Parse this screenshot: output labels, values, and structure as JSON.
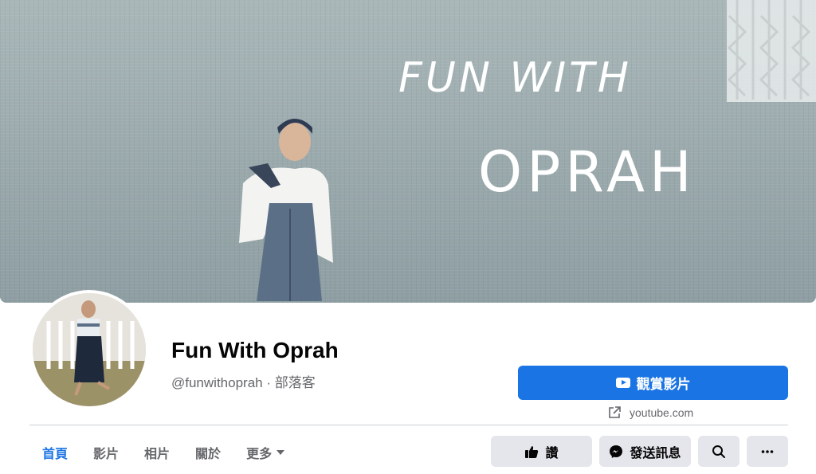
{
  "cover": {
    "text_line1": "FUN WITH",
    "text_line2": "OPRAH"
  },
  "page": {
    "name": "Fun With Oprah",
    "handle_category": "@funwithoprah · 部落客"
  },
  "actions": {
    "watch_label": "觀賞影片",
    "website": "youtube.com",
    "like_label": "讚",
    "message_label": "發送訊息"
  },
  "tabs": [
    {
      "label": "首頁",
      "active": true
    },
    {
      "label": "影片"
    },
    {
      "label": "相片"
    },
    {
      "label": "關於"
    },
    {
      "label": "更多"
    }
  ],
  "icons": {
    "watch": "play-icon",
    "website": "external-link-icon",
    "like": "thumbs-up-icon",
    "message": "messenger-icon",
    "search": "search-icon",
    "more": "ellipsis-icon",
    "more_tab": "caret-down-icon"
  },
  "colors": {
    "accent": "#1b74e4",
    "secondary_button": "#e4e6eb",
    "muted_text": "#65676b"
  }
}
